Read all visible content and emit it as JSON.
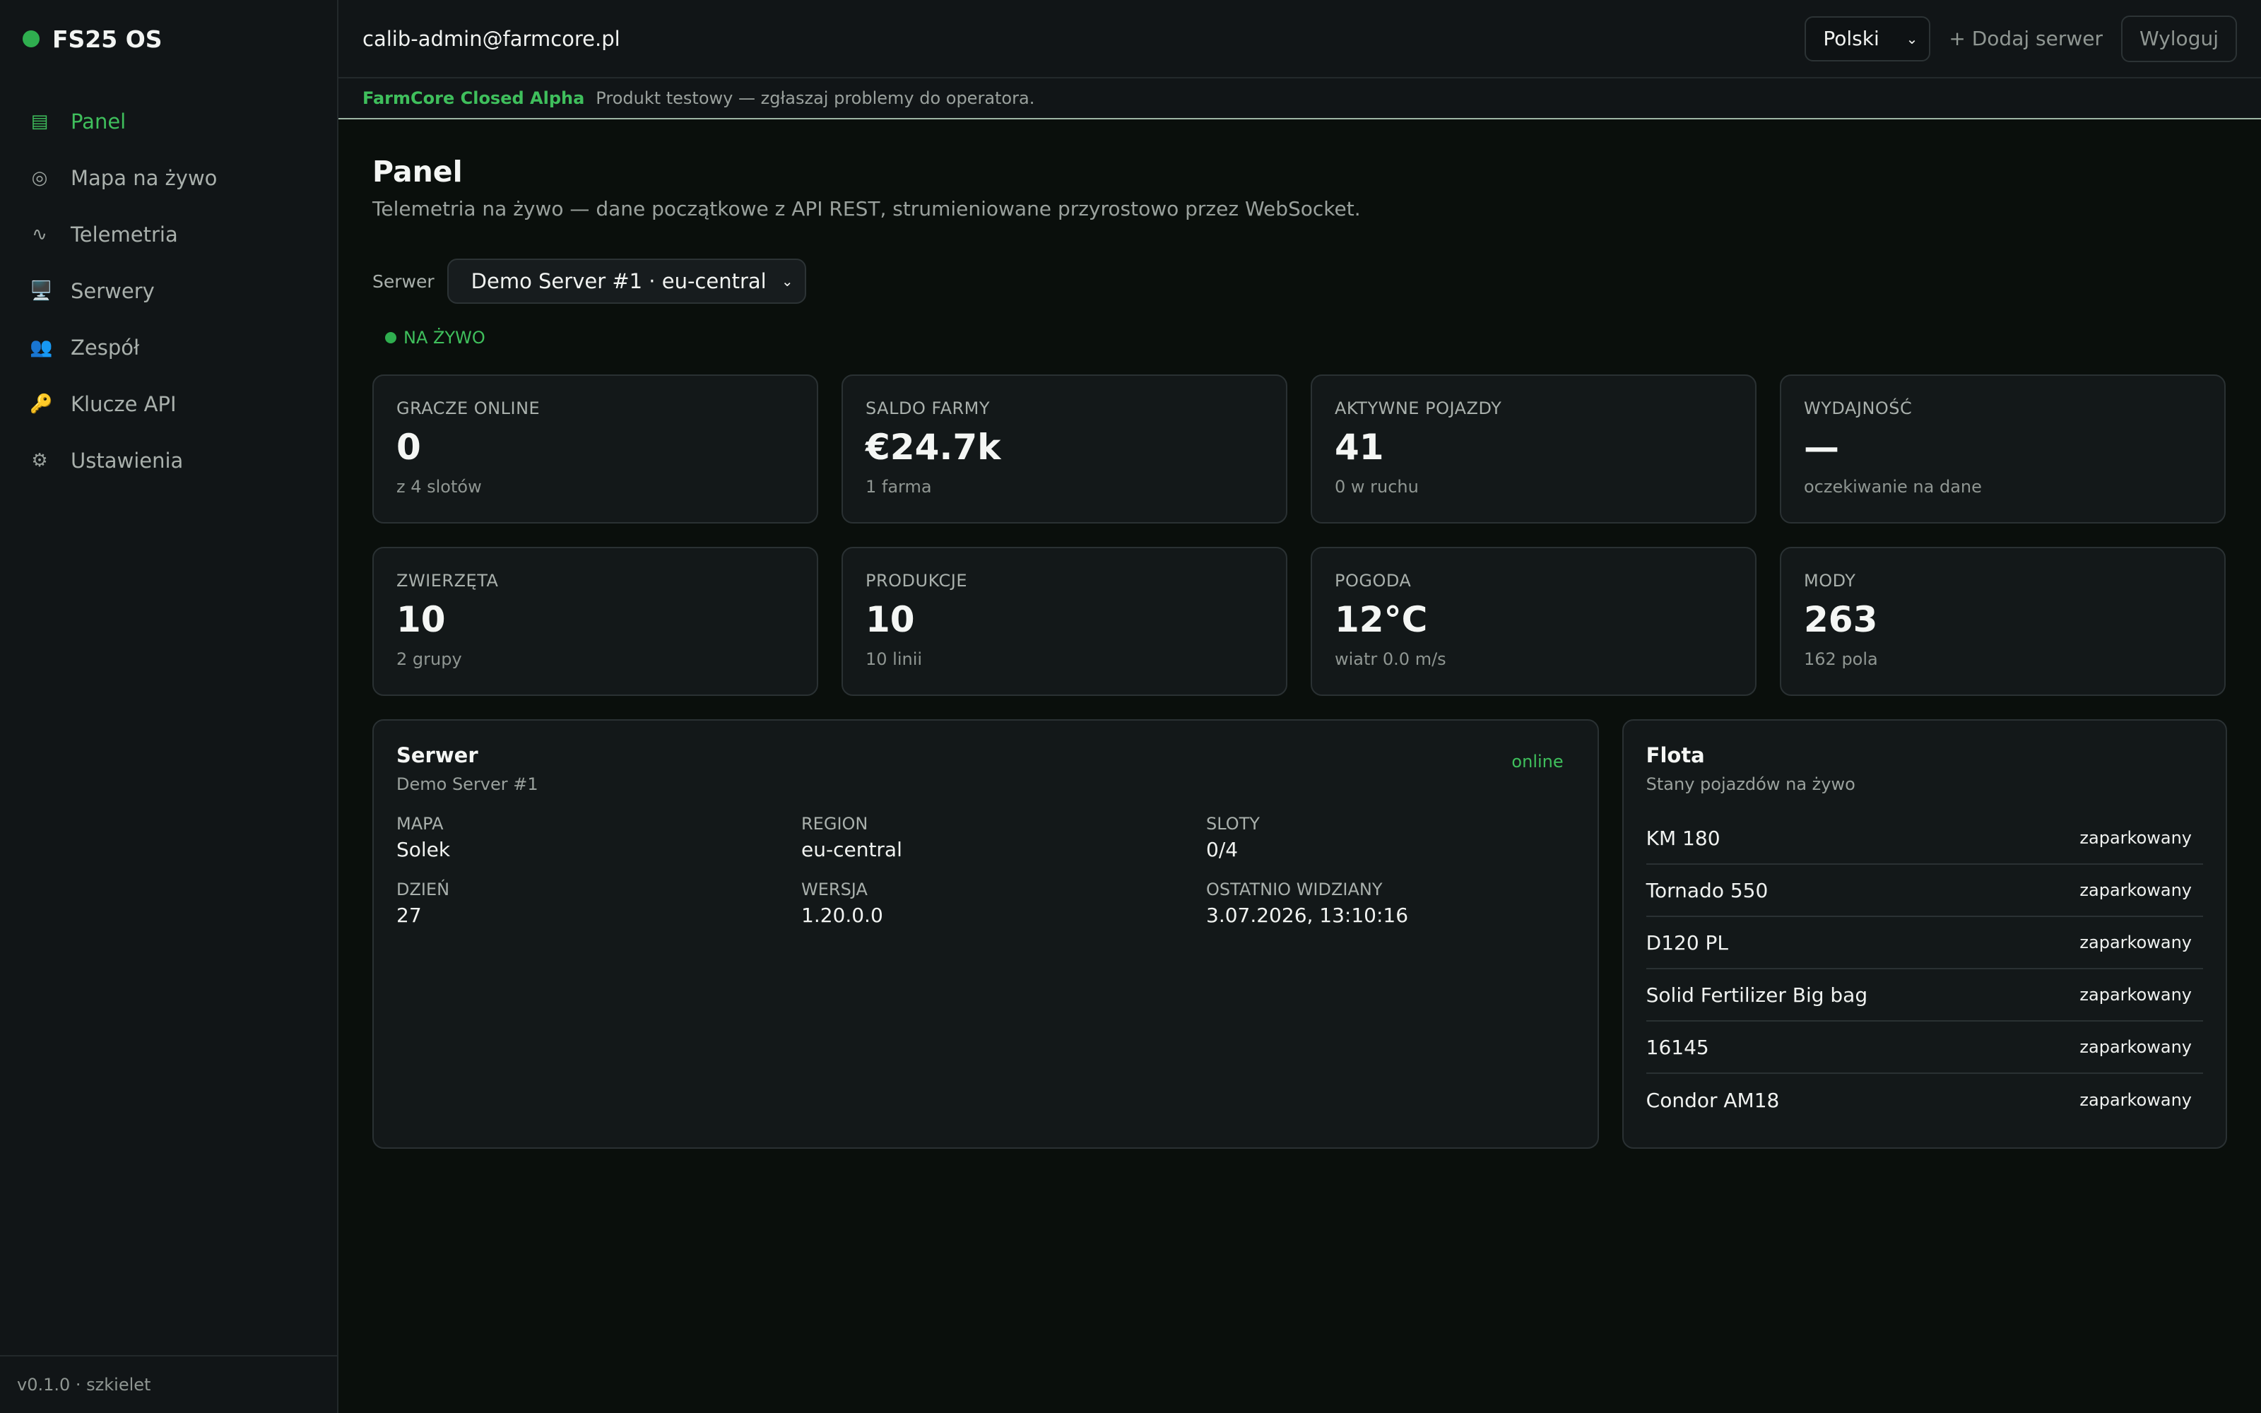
{
  "sidebar": {
    "brand": "FS25 OS",
    "items": [
      {
        "label": "Panel",
        "icon": "dashboard-icon",
        "glyph": "▤",
        "active": true
      },
      {
        "label": "Mapa na żywo",
        "icon": "map-icon",
        "glyph": "◎"
      },
      {
        "label": "Telemetria",
        "icon": "telemetry-icon",
        "glyph": "∿"
      },
      {
        "label": "Serwery",
        "icon": "computer-icon",
        "glyph": "🖥️"
      },
      {
        "label": "Zespół",
        "icon": "team-icon",
        "glyph": "👥"
      },
      {
        "label": "Klucze API",
        "icon": "key-icon",
        "glyph": "🔑"
      },
      {
        "label": "Ustawienia",
        "icon": "gear-icon",
        "glyph": "⚙"
      }
    ],
    "footer": "v0.1.0 · szkielet"
  },
  "topbar": {
    "email": "calib-admin@farmcore.pl",
    "language": "Polski",
    "add_server": "+ Dodaj serwer",
    "logout": "Wyloguj"
  },
  "alpha": {
    "tag": "FarmCore Closed Alpha",
    "text": "Produkt testowy — zgłaszaj problemy do operatora."
  },
  "page": {
    "title": "Panel",
    "subtitle": "Telemetria na żywo — dane początkowe z API REST, strumieniowane przyrostowo przez WebSocket."
  },
  "server_select": {
    "label": "Serwer",
    "value": "Demo Server #1 · eu-central"
  },
  "live": "NA ŻYWO",
  "stats": [
    {
      "label": "GRACZE ONLINE",
      "value": "0",
      "sub": "z 4 slotów"
    },
    {
      "label": "SALDO FARMY",
      "value": "€24.7k",
      "sub": "1 farma"
    },
    {
      "label": "AKTYWNE POJAZDY",
      "value": "41",
      "sub": "0 w ruchu"
    },
    {
      "label": "WYDAJNOŚĆ",
      "value": "—",
      "sub": "oczekiwanie na dane"
    },
    {
      "label": "ZWIERZĘTA",
      "value": "10",
      "sub": "2 grupy"
    },
    {
      "label": "PRODUKCJE",
      "value": "10",
      "sub": "10 linii"
    },
    {
      "label": "POGODA",
      "value": "12°C",
      "sub": "wiatr 0.0 m/s"
    },
    {
      "label": "MODY",
      "value": "263",
      "sub": "162 pola"
    }
  ],
  "server_panel": {
    "title": "Serwer",
    "name": "Demo Server #1",
    "status": "online",
    "fields": [
      {
        "label": "MAPA",
        "value": "Solek"
      },
      {
        "label": "REGION",
        "value": "eu-central"
      },
      {
        "label": "SLOTY",
        "value": "0/4"
      },
      {
        "label": "DZIEŃ",
        "value": "27"
      },
      {
        "label": "WERSJA",
        "value": "1.20.0.0"
      },
      {
        "label": "OSTATNIO WIDZIANY",
        "value": "3.07.2026, 13:10:16"
      }
    ]
  },
  "fleet": {
    "title": "Flota",
    "subtitle": "Stany pojazdów na żywo",
    "vehicles": [
      {
        "name": "KM 180",
        "status": "zaparkowany"
      },
      {
        "name": "Tornado 550",
        "status": "zaparkowany"
      },
      {
        "name": "D120 PL",
        "status": "zaparkowany"
      },
      {
        "name": "Solid Fertilizer Big bag",
        "status": "zaparkowany"
      },
      {
        "name": "16145",
        "status": "zaparkowany"
      },
      {
        "name": "Condor AM18",
        "status": "zaparkowany"
      }
    ]
  }
}
